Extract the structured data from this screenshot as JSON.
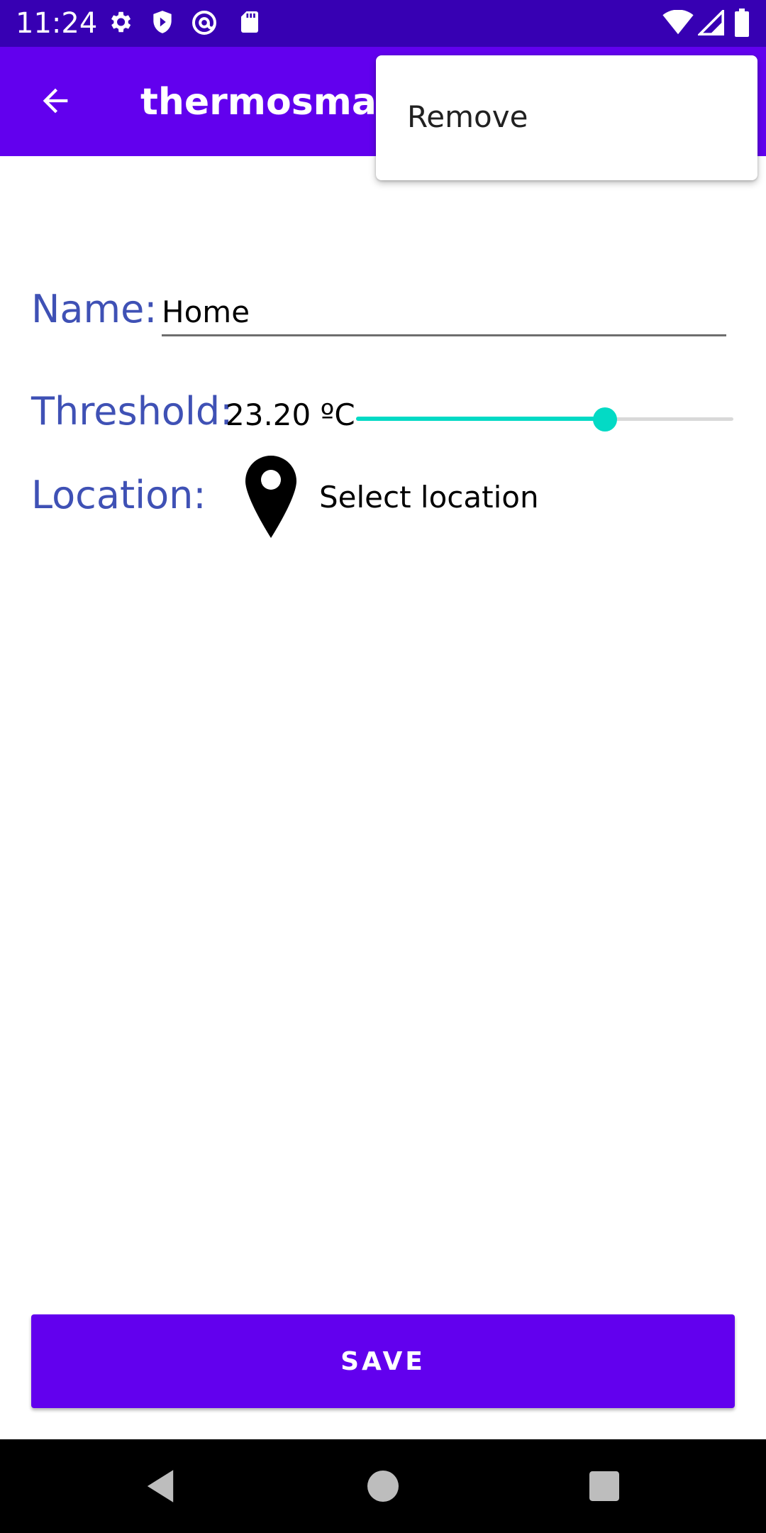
{
  "status_bar": {
    "time": "11:24",
    "left_icons": [
      "settings-icon",
      "shield-icon",
      "at-sign-icon",
      "sd-card-icon"
    ],
    "right_icons": [
      "wifi-icon",
      "signal-icon",
      "battery-icon"
    ]
  },
  "app_bar": {
    "title": "thermosmart",
    "back_icon": "arrow-left-icon"
  },
  "popup_menu": {
    "items": [
      {
        "label": "Remove"
      }
    ]
  },
  "form": {
    "name_label": "Name:",
    "name_value": "Home",
    "threshold_label": "Threshold:",
    "threshold_value": "23.20 ºC",
    "threshold_slider_fraction": 0.66,
    "location_label": "Location:",
    "location_icon": "map-pin-icon",
    "location_text": "Select location"
  },
  "save_label": "SAVE",
  "nav_bar": {
    "icons": [
      "back-triangle-icon",
      "home-circle-icon",
      "recents-square-icon"
    ]
  },
  "colors": {
    "status_bar": "#3700B3",
    "primary": "#6200EE",
    "label": "#3F51B5",
    "accent": "#03DAC5"
  }
}
